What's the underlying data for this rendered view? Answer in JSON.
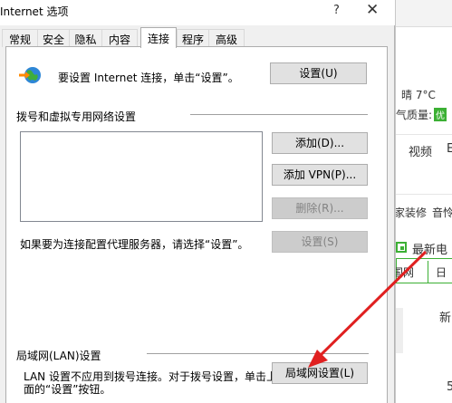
{
  "dialog": {
    "title": "Internet 选项",
    "help_glyph": "?",
    "close_glyph": "✕",
    "tabs": [
      {
        "label": "常规"
      },
      {
        "label": "安全"
      },
      {
        "label": "隐私"
      },
      {
        "label": "内容"
      },
      {
        "label": "连接",
        "active": true
      },
      {
        "label": "程序"
      },
      {
        "label": "高级"
      }
    ]
  },
  "connections": {
    "setup_text": "要设置 Internet 连接，单击“设置”。",
    "setup_button": "设置(U)",
    "dialup_group_title": "拨号和虚拟专用网络设置",
    "add_button": "添加(D)...",
    "add_vpn_button": "添加 VPN(P)...",
    "delete_button": "删除(R)...",
    "proxy_text": "如果要为连接配置代理服务器，请选择“设置”。",
    "settings_button": "设置(S)",
    "lan_group_title": "局域网(LAN)设置",
    "lan_text_line1": "LAN 设置不应用到拨号连接。对于拨号设置，单击上",
    "lan_text_line2": "面的“设置”按钮。",
    "lan_button": "局域网设置(L)"
  },
  "background_page": {
    "weather": "晴  7°C",
    "air_quality_label": "气质量:",
    "air_quality_value": "优",
    "video_label": "视频",
    "video_label2": "E",
    "decor_label": "家装修",
    "music_label": "音怜",
    "latest_label": "最新电",
    "bureau_label": "国网",
    "bureau_label2": "日",
    "new_label": "新",
    "num_label": "5"
  },
  "colors": {
    "accent_green": "#3cb034",
    "arrow_red": "#e02020"
  }
}
